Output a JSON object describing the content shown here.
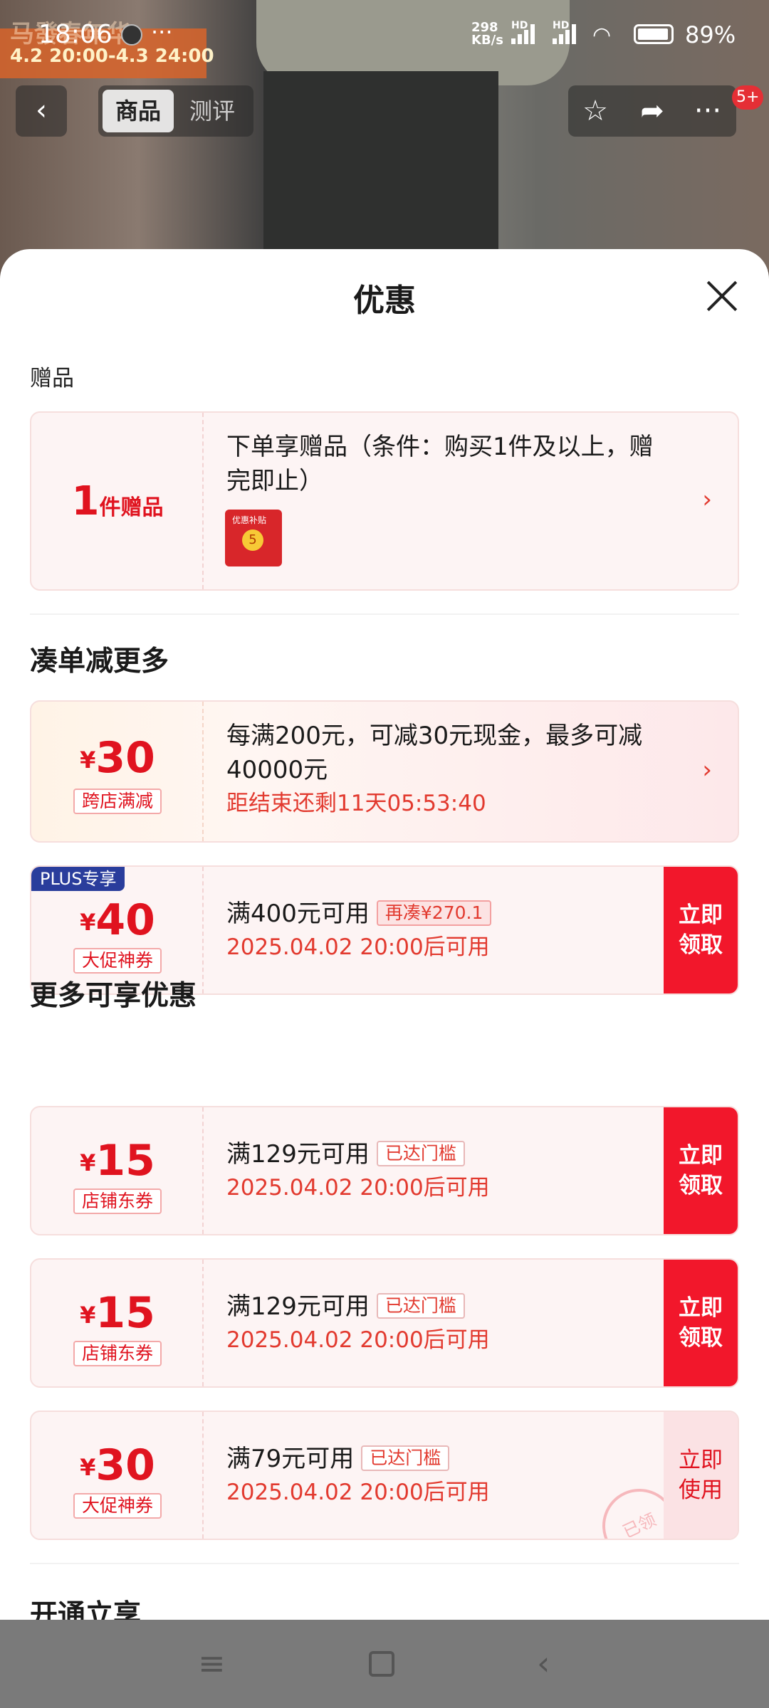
{
  "status_bar": {
    "time": "18:06",
    "dots": "···",
    "net_speed_top": "298",
    "net_speed_bottom": "KB/s",
    "hd1": "HD",
    "hd2": "HD",
    "battery": "89%"
  },
  "background": {
    "promo_title": "马發春年华",
    "promo_date": "4.2 20:00-4.3 24:00"
  },
  "top_nav": {
    "tab_product": "商品",
    "tab_review": "测评",
    "badge": "5+"
  },
  "sheet": {
    "title": "优惠",
    "gift_section": {
      "label": "赠品",
      "count": "1",
      "count_unit": "件赠品",
      "text": "下单享赠品（条件：购买1件及以上，赠完即止）"
    },
    "bundle_section": {
      "title": "凑单减更多",
      "promo": {
        "yen": "¥",
        "amount": "30",
        "tag": "跨店满减",
        "text": "每满200元，可减30元现金，最多可减40000元",
        "countdown": "距结束还剩11天05:53:40"
      },
      "plus_coupon": {
        "plus_tag": "PLUS专享",
        "yen": "¥",
        "amount": "40",
        "tag": "大促神券",
        "condition": "满400元可用",
        "pill": "再凑¥270.1",
        "valid": "2025.04.02 20:00后可用",
        "cta": "立即领取"
      }
    },
    "more_section": {
      "title": "更多可享优惠",
      "coupons": [
        {
          "yen": "¥",
          "amount": "15",
          "tag": "店铺东券",
          "condition": "满129元可用",
          "pill": "已达门槛",
          "valid": "2025.04.02 20:00后可用",
          "cta": "立即领取"
        },
        {
          "yen": "¥",
          "amount": "15",
          "tag": "店铺东券",
          "condition": "满129元可用",
          "pill": "已达门槛",
          "valid": "2025.04.02 20:00后可用",
          "cta": "立即领取"
        },
        {
          "yen": "¥",
          "amount": "30",
          "tag": "大促神券",
          "condition": "满79元可用",
          "pill": "已达门槛",
          "valid": "2025.04.02 20:00后可用",
          "cta": "立即使用",
          "stamp": "已领"
        }
      ]
    },
    "next_section_title": "开通立享"
  },
  "colors": {
    "accent": "#e0131f",
    "cta_bg": "#f2172b",
    "plus_blue": "#2a3d9c"
  }
}
